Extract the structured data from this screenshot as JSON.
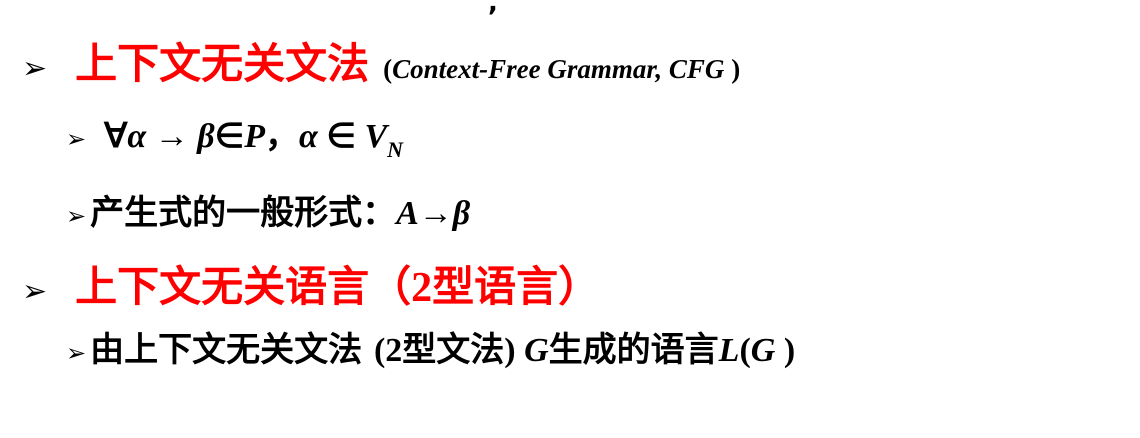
{
  "slide": {
    "top_mark": ",",
    "arrow_glyph": "➢",
    "item1": {
      "title": "上下文无关文法",
      "paren_open": "(",
      "paren_text": "Context-Free Grammar, CFG",
      "paren_close": " )"
    },
    "item1_sub1": {
      "forall": "∀",
      "alpha": "α",
      "to": " → ",
      "beta": "β",
      "in": "∈",
      "P": "P",
      "sep": "，",
      "alpha2": "α",
      "in2": " ∈ ",
      "V": "V",
      "N": "N"
    },
    "item1_sub2": {
      "label": "产生式的一般形式：",
      "A": "A",
      "to": "→",
      "beta": "β"
    },
    "item2": {
      "title": "上下文无关语言（",
      "num": "2",
      "title_end": "型语言）"
    },
    "item2_sub1": {
      "part1": "由上下文无关文法 ",
      "paren_open": "(",
      "num": "2",
      "part2": "型文法",
      "paren_close": ") ",
      "G": "G",
      "part3": "生成的语言",
      "L": "L",
      "lparen": "(",
      "G2": "G",
      "rparen": " )"
    }
  }
}
